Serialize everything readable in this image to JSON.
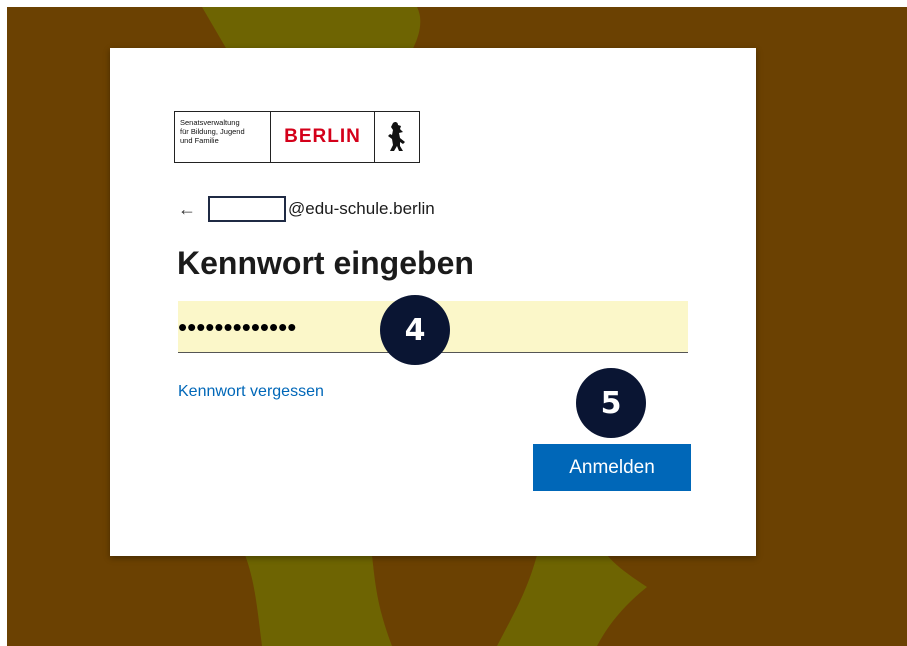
{
  "logo": {
    "senate_lines": [
      "Senatsverwaltung",
      "für Bildung, Jugend",
      "und Familie"
    ],
    "berlin_label": "BERLIN",
    "bear_icon": "berlin-bear-icon"
  },
  "identity": {
    "back_icon": "arrow-left-icon",
    "back_glyph": "←",
    "domain_suffix": "@edu-schule.berlin"
  },
  "heading": "Kennwort eingeben",
  "password": {
    "masked_value": "•••••••••••••"
  },
  "forgot_link": "Kennwort vergessen",
  "signin_button": "Anmelden",
  "step_badges": {
    "password_step": "4",
    "signin_step": "5"
  },
  "colors": {
    "background": "#6b4102",
    "bear_silhouette": "#6e6402",
    "accent_blue": "#0067b8",
    "field_fill": "#fbf7c9",
    "badge": "#0a1533"
  }
}
